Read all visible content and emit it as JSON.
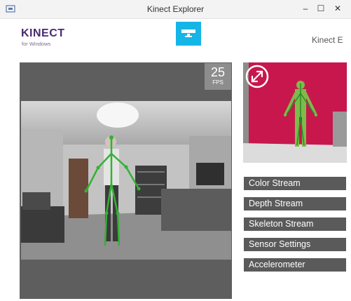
{
  "window": {
    "title": "Kinect Explorer",
    "controls": {
      "minimize": "–",
      "maximize": "☐",
      "close": "✕"
    }
  },
  "header": {
    "logo": "KINECT",
    "logo_sub": "for Windows",
    "right_text": "Kinect E"
  },
  "viewer": {
    "fps_value": "25",
    "fps_label": "FPS"
  },
  "nav": {
    "items": [
      {
        "label": "Color Stream"
      },
      {
        "label": "Depth Stream"
      },
      {
        "label": "Skeleton Stream"
      },
      {
        "label": "Sensor Settings"
      },
      {
        "label": "Accelerometer"
      }
    ]
  },
  "colors": {
    "accent": "#15b5e6",
    "logo": "#4a2a72",
    "nav_bg": "#5a5a5a",
    "skeleton": "#33b233",
    "depth_bg": "#c8174d"
  }
}
